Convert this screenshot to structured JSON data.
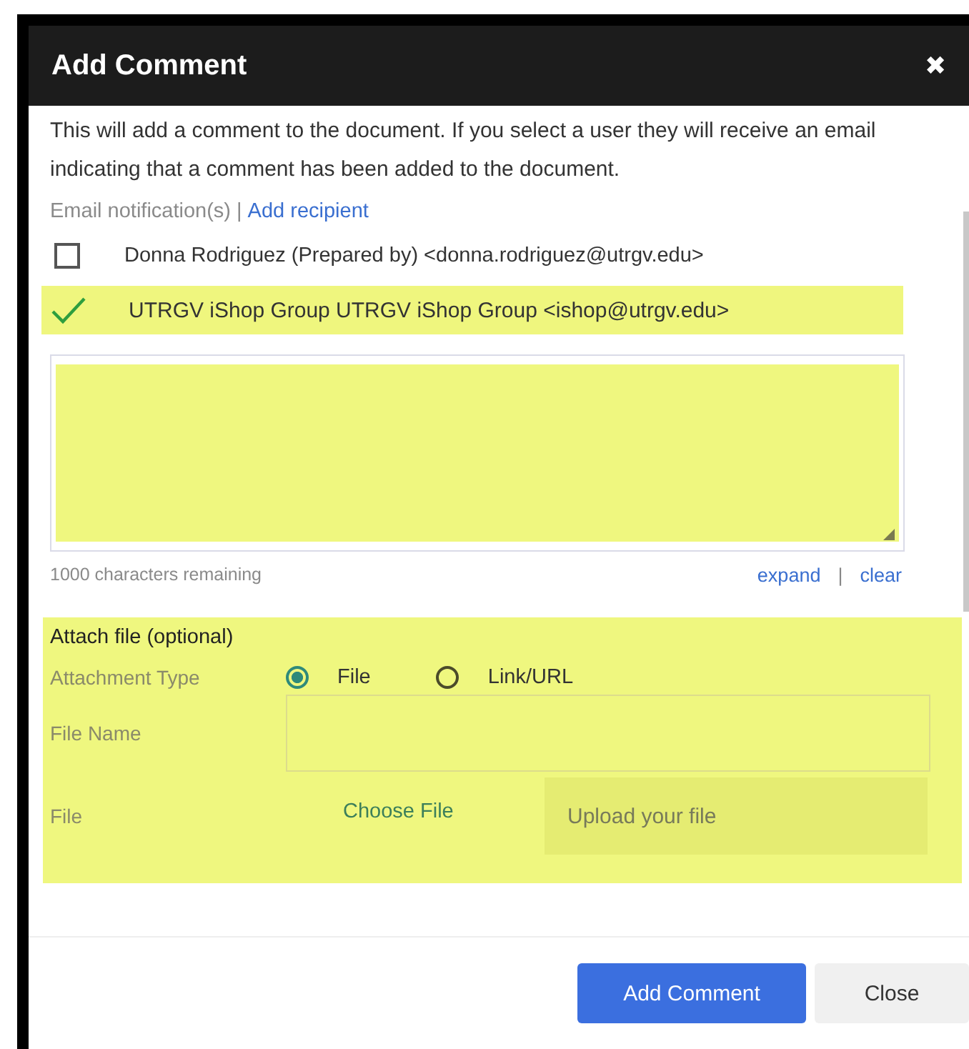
{
  "dialog": {
    "title": "Add Comment",
    "close": "✖"
  },
  "description": "This will add a comment to the document. If you select a user they will receive an email indicating that a comment has been added to the document.",
  "notifications": {
    "label": "Email notification(s)",
    "separator": "|",
    "link": "Add recipient"
  },
  "recipients": [
    {
      "label": "Donna Rodriguez (Prepared by) <donna.rodriguez@utrgv.edu>",
      "checked": false
    },
    {
      "label": "UTRGV iShop Group UTRGV iShop Group <ishop@utrgv.edu>",
      "checked": true
    }
  ],
  "comment": {
    "remaining": "1000 characters remaining",
    "links": [
      "expand",
      "clear"
    ],
    "separator": "|"
  },
  "attachment": {
    "heading": "Attach file (optional)",
    "type_label": "Attachment Type",
    "types": [
      {
        "label": "File",
        "selected": true
      },
      {
        "label": "Link/URL",
        "selected": false
      }
    ],
    "file_name_label": "File Name",
    "file_label": "File",
    "choose": "Choose File",
    "upload_placeholder": "Upload your file"
  },
  "buttons": [
    {
      "label": "Add Comment",
      "kind": "primary"
    },
    {
      "label": "Close",
      "kind": "secondary"
    }
  ]
}
